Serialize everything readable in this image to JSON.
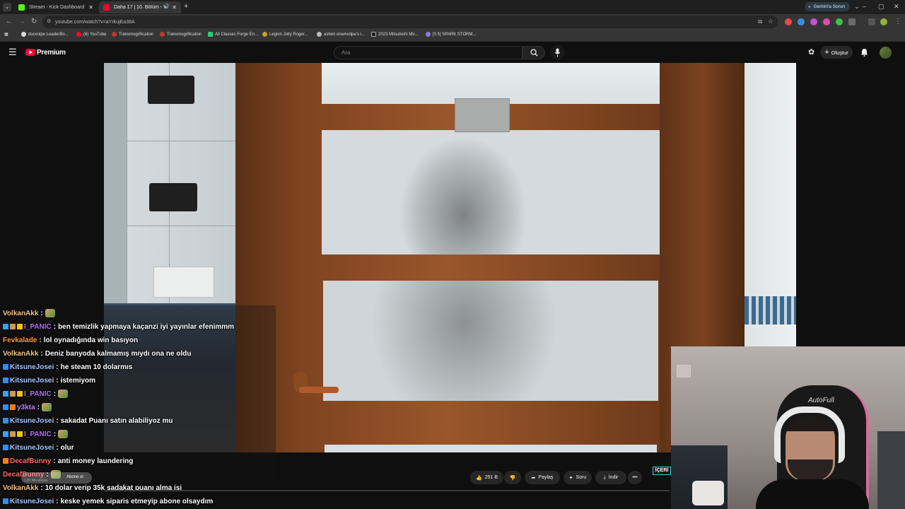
{
  "browser": {
    "tabs": [
      {
        "title": "Stream - Kick Dashboard",
        "active": false,
        "favicon_color": "#53fc18"
      },
      {
        "title": "Daha 17 | 10. Bölüm - YouTube",
        "active": true,
        "favicon_color": "#ff0033"
      }
    ],
    "new_tab": "+",
    "url": "youtube.com/watch?v=aYrkujEa38A",
    "gemini_label": "Gemini'a Sorun",
    "bookmarks": [
      "ducvolpe LeaderBo...",
      "(6) YouTube",
      "Transmogrification",
      "Transmogrification",
      "All Classes Forge En...",
      "Legion Jolly Roger...",
      "ashen one#volpe's l...",
      "2023 Mitsubishi Mir...",
      "[0.5] SPARK STORM..."
    ]
  },
  "youtube": {
    "logo": "Premium",
    "search_placeholder": "Ara",
    "create_label": "Oluştur",
    "actions": {
      "likes": "251 B",
      "share": "Paylaş",
      "ask": "Soru",
      "download": "İndir",
      "more": "•••"
    },
    "channel_meta": "1,87 Mn abone",
    "subscribe": "Abone ol"
  },
  "chat": {
    "messages": [
      {
        "user": "VolkanAkk",
        "color": "#f1c48a",
        "text": "",
        "emote": true,
        "badges": []
      },
      {
        "user": "I_PANIC",
        "color": "#b46cff",
        "text": "ben temizlik yapmaya kaçanzi iyi yayınlar efenimmm",
        "badges": [
          "#3aa0ff",
          "#c89a5a",
          "#f5c400"
        ]
      },
      {
        "user": "Fevkalade",
        "color": "#ff9a3c",
        "text": "lol oynadığında win basıyon",
        "badges": []
      },
      {
        "user": "VolkanAkk",
        "color": "#f1c48a",
        "text": "Deniz banyoda kalmamış mıydı ona ne oldu",
        "badges": []
      },
      {
        "user": "KitsuneJosei",
        "color": "#a7c7ff",
        "text": "he steam 10 dolarmıs",
        "badges": [
          "#2f8dff"
        ]
      },
      {
        "user": "KitsuneJosei",
        "color": "#a7c7ff",
        "text": "istemiyom",
        "badges": [
          "#2f8dff"
        ]
      },
      {
        "user": "I_PANIC",
        "color": "#b46cff",
        "text": "",
        "emote": true,
        "badges": [
          "#3aa0ff",
          "#c89a5a",
          "#f5c400"
        ]
      },
      {
        "user": "y3kta",
        "color": "#c77dff",
        "text": "",
        "emote": true,
        "badges": [
          "#2f8dff",
          "#ff7b1c"
        ]
      },
      {
        "user": "KitsuneJosei",
        "color": "#a7c7ff",
        "text": "sakadat Puanı satın alabiliyoz mu",
        "badges": [
          "#2f8dff"
        ]
      },
      {
        "user": "I_PANIC",
        "color": "#b46cff",
        "text": "",
        "emote": true,
        "badges": [
          "#3aa0ff",
          "#c89a5a",
          "#f5c400"
        ]
      },
      {
        "user": "KitsuneJosei",
        "color": "#a7c7ff",
        "text": "olur",
        "badges": [
          "#2f8dff"
        ]
      },
      {
        "user": "DecafBunny",
        "color": "#ff6b6b",
        "text": "anti money laundering",
        "badges": [
          "#ff7b1c"
        ]
      },
      {
        "user": "DecafBunny",
        "color": "#ff6b6b",
        "text": "",
        "emote": true,
        "badges": []
      },
      {
        "user": "VolkanAkk",
        "color": "#f1c48a",
        "text": "10 dolar verip 35k sadakat puanı alma işi",
        "badges": []
      },
      {
        "user": "KitsuneJosei",
        "color": "#a7c7ff",
        "text": "keske yemek siparis etmeyip abone olsaydım",
        "badges": [
          "#2f8dff"
        ]
      }
    ]
  },
  "webcam": {
    "chair_brand": "AutoFull"
  },
  "overlay_tag": "İÇERİ"
}
